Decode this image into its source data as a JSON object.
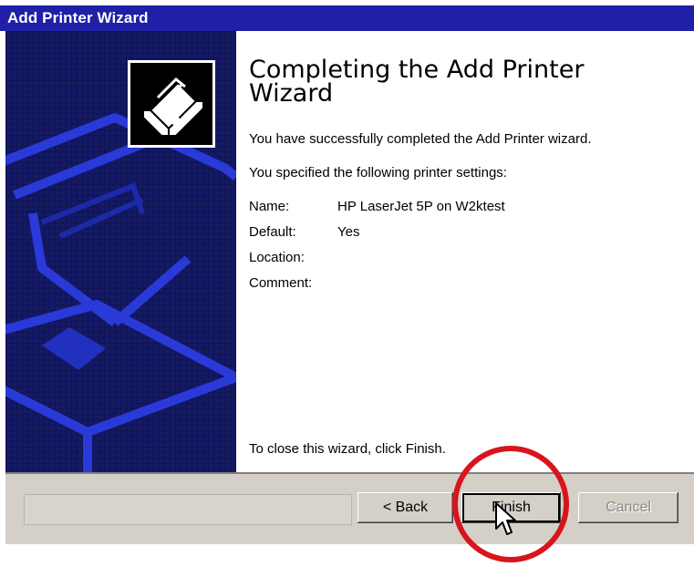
{
  "window": {
    "title": "Add Printer Wizard"
  },
  "heading": "Completing the Add Printer Wizard",
  "success_text": "You have successfully completed the Add Printer wizard.",
  "settings_intro": "You specified the following printer settings:",
  "settings": [
    {
      "label": "Name:",
      "value": "HP LaserJet 5P on W2ktest"
    },
    {
      "label": "Default:",
      "value": "Yes"
    },
    {
      "label": "Location:",
      "value": ""
    },
    {
      "label": "Comment:",
      "value": ""
    }
  ],
  "close_instruction": "To close this wizard, click Finish.",
  "buttons": {
    "back": "< Back",
    "finish": "Finish",
    "cancel": "Cancel"
  },
  "icons": {
    "printer": "printer-icon",
    "cursor": "mouse-pointer-icon"
  },
  "colors": {
    "titlebar": "#1f1fa8",
    "left_panel": "#141a66",
    "callout": "#d8141e",
    "dialog_face": "#d4d0c8"
  }
}
